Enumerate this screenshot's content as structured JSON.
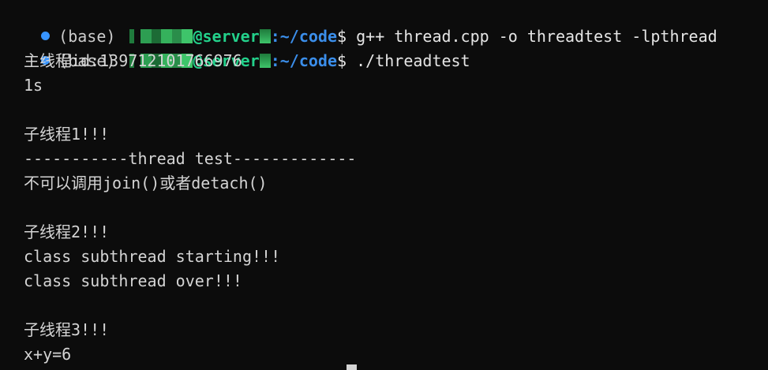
{
  "prompts": [
    {
      "env": "(base)",
      "host": "@server",
      "path": ":~/code",
      "symbol": "$",
      "command": "g++ thread.cpp -o threadtest -lpthread"
    },
    {
      "env": "(base)",
      "host": "@server",
      "path": ":~/code",
      "symbol": "$",
      "command": "./threadtest"
    }
  ],
  "output": [
    "主线程id:139712101766976",
    "1s",
    "",
    "子线程1!!!",
    "-----------thread test-------------",
    "不可以调用join()或者detach()",
    "",
    "子线程2!!!",
    "class subthread starting!!!",
    "class subthread over!!!",
    "",
    "子线程3!!!",
    "x+y=6"
  ],
  "colors": {
    "background": "#0c0c0c",
    "text": "#d4d4d4",
    "status_dot": "#3794ff",
    "host": "#23d18b",
    "path": "#3b8eea"
  }
}
